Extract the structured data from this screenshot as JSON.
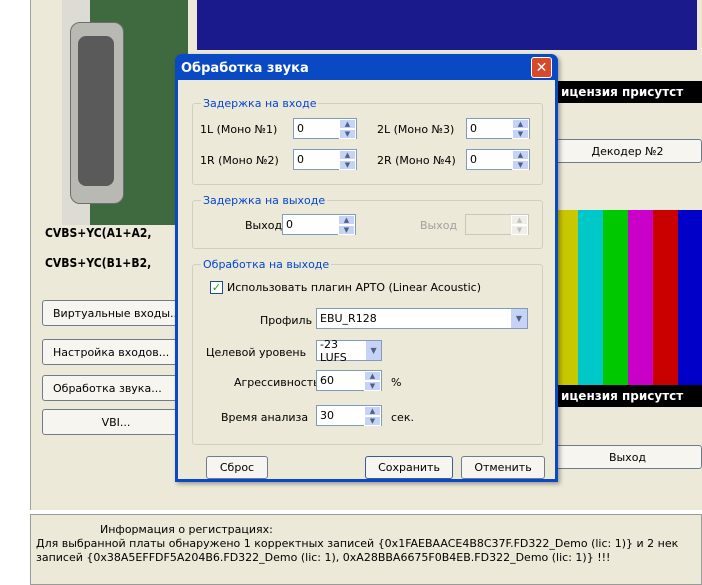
{
  "background": {
    "board_labels": [
      "CVBS+YC(A1+A2,",
      "CVBS+YC(B1+B2,"
    ],
    "left_buttons": [
      "Виртуальные входы...",
      "Настройка входов...",
      "Обработка звука...",
      "VBI..."
    ],
    "license_text": "ицензия присутст",
    "decoder_button": "Декодер №2",
    "exit_button": "Выход",
    "colorbar_colors": [
      "#c8c800",
      "#00c8c8",
      "#00c800",
      "#c800c8",
      "#c80000",
      "#0000c8"
    ],
    "info": {
      "title": "Информация о регистрациях:",
      "line1": "Для выбранной платы обнаружено 1 корректных записей {0x1FAEBAACE4B8C37F.FD322_Demo (lic: 1)} и 2 нек",
      "line2": "записей {0x38A5EFFDF5A204B6.FD322_Demo (lic: 1), 0xA28BBA6675F0B4EB.FD322_Demo (lic: 1)} !!!"
    }
  },
  "dialog": {
    "title": "Обработка звука",
    "close_glyph": "✕",
    "input_delay": {
      "title": "Задержка на входе",
      "l1_label": "1L (Моно №1)",
      "l1_value": "0",
      "r1_label": "1R (Моно №2)",
      "r1_value": "0",
      "l2_label": "2L (Моно №3)",
      "l2_value": "0",
      "r2_label": "2R (Моно №4)",
      "r2_value": "0"
    },
    "output_delay": {
      "title": "Задержка на выходе",
      "out1_label": "Выход",
      "out1_value": "0",
      "out2_label": "Выход",
      "out2_value": ""
    },
    "output_processing": {
      "title": "Обработка на выходе",
      "plugin_checkbox_label": "Использовать плагин APTO (Linear Acoustic)",
      "plugin_checked": true,
      "profile_label": "Профиль",
      "profile_value": "EBU_R128",
      "target_label": "Целевой уровень",
      "target_value": "-23 LUFS",
      "aggr_label": "Агрессивность",
      "aggr_value": "60",
      "aggr_unit": "%",
      "time_label": "Время анализа",
      "time_value": "30",
      "time_unit": "сек."
    },
    "buttons": {
      "reset": "Сброс",
      "save": "Сохранить",
      "cancel": "Отменить"
    }
  }
}
